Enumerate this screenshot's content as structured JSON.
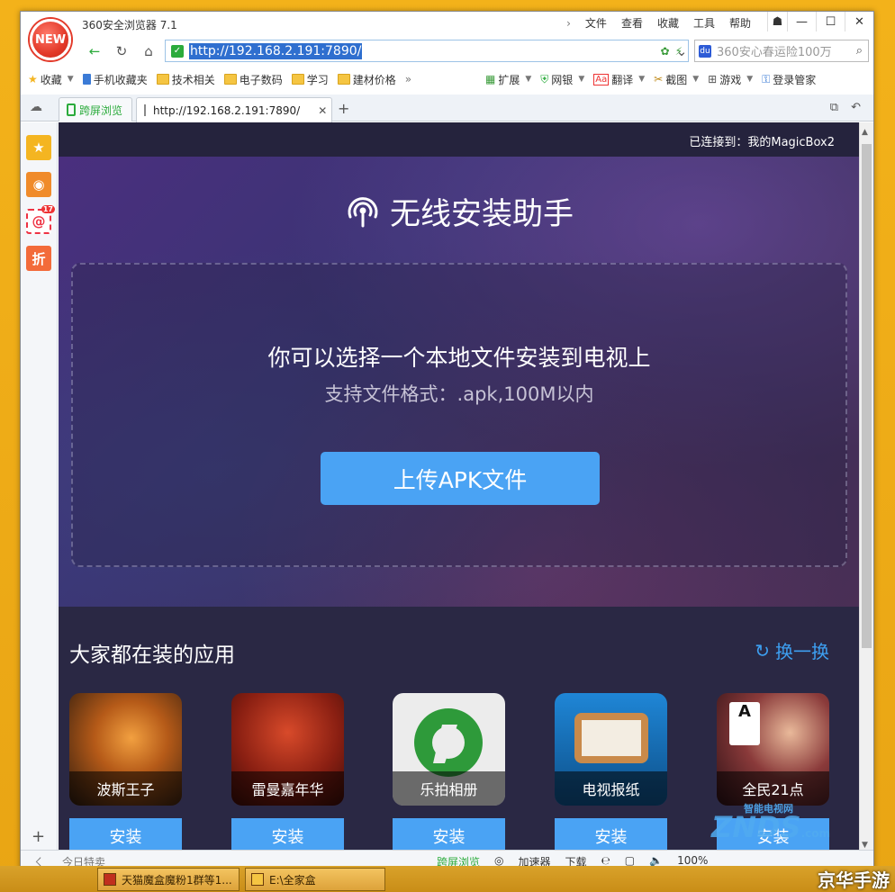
{
  "browser": {
    "app_title": "360安全浏览器 7.1",
    "logo_text": "NEW",
    "menu": [
      "文件",
      "查看",
      "收藏",
      "工具",
      "帮助"
    ],
    "url": "http://192.168.2.191:7890/",
    "search_placeholder": "360安心春运险100万"
  },
  "bookmarks": {
    "left": [
      "收藏",
      "手机收藏夹",
      "技术相关",
      "电子数码",
      "学习",
      "建材价格"
    ],
    "right": [
      "扩展",
      "网银",
      "翻译",
      "截图",
      "游戏",
      "登录管家"
    ]
  },
  "tabs": {
    "items": [
      {
        "label": "跨屏浏览"
      },
      {
        "label": "http://192.168.2.191:7890/"
      }
    ]
  },
  "page": {
    "connected": "已连接到：我的MagicBox2",
    "title": "无线安装助手",
    "dropzone_line1": "你可以选择一个本地文件安装到电视上",
    "dropzone_line2": "支持文件格式：.apk,100M以内",
    "upload_label": "上传APK文件",
    "apps_title": "大家都在装的应用",
    "refresh_label": "换一换",
    "install_label": "安装",
    "apps": [
      {
        "name": "波斯王子",
        "color_a": "#c9661e",
        "color_b": "#3a2410"
      },
      {
        "name": "雷曼嘉年华",
        "color_a": "#a8321d",
        "color_b": "#4a140d"
      },
      {
        "name": "乐拍相册",
        "color_a": "#e8e8e8",
        "color_b": "#2e9a3a"
      },
      {
        "name": "电视报纸",
        "color_a": "#1b7bc6",
        "color_b": "#0d4f88"
      },
      {
        "name": "全民21点",
        "color_a": "#8a2f3a",
        "color_b": "#2a0f14"
      }
    ]
  },
  "statusbar": {
    "left": [
      "今日特卖"
    ],
    "right": [
      "跨屏浏览",
      "加速器",
      "下载",
      "100%"
    ]
  },
  "taskbar": {
    "items": [
      "天猫魔盒魔粉1群等1...",
      "E:\\全家盒"
    ],
    "corner_logo": "京华手游"
  },
  "watermark": {
    "top": "智能电视网",
    "main": "ZNDS",
    "suffix": ".com"
  }
}
